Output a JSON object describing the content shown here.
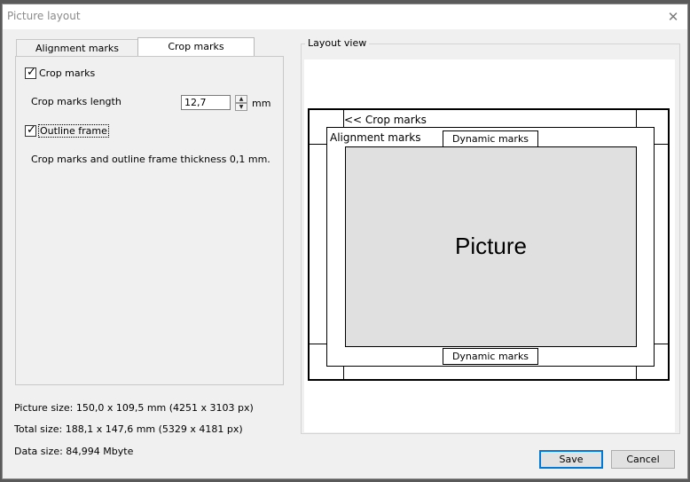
{
  "window": {
    "title": "Picture layout"
  },
  "tabs": [
    {
      "label": "Alignment marks",
      "active": false
    },
    {
      "label": "Crop marks",
      "active": true
    }
  ],
  "crop_tab": {
    "crop_marks": {
      "label": "Crop marks",
      "checked": true
    },
    "length_label": "Crop marks length",
    "length_value": "12,7",
    "length_unit": "mm",
    "outline_frame": {
      "label": "Outline frame",
      "checked": true
    },
    "thickness_note": "Crop marks and outline frame thickness  0,1 mm."
  },
  "layout_view": {
    "legend": "Layout view",
    "crop_marks_label": "<< Crop marks",
    "alignment_marks_label": "Alignment marks",
    "dynamic_marks_top": "Dynamic marks",
    "dynamic_marks_bottom": "Dynamic marks",
    "picture_label": "Picture"
  },
  "info": {
    "picture_size": "Picture size: 150,0 x 109,5 mm (4251 x 3103 px)",
    "total_size": "Total size: 188,1 x 147,6 mm (5329 x 4181 px)",
    "data_size": "Data size: 84,994 Mbyte"
  },
  "buttons": {
    "save": "Save",
    "cancel": "Cancel"
  },
  "colors": {
    "accent": "#0078d7",
    "picture_fill": "#e0e0e0"
  },
  "icons": {
    "close": "close-icon",
    "spin_up": "arrow-up-icon",
    "spin_down": "arrow-down-icon",
    "checkbox": "check-icon"
  }
}
